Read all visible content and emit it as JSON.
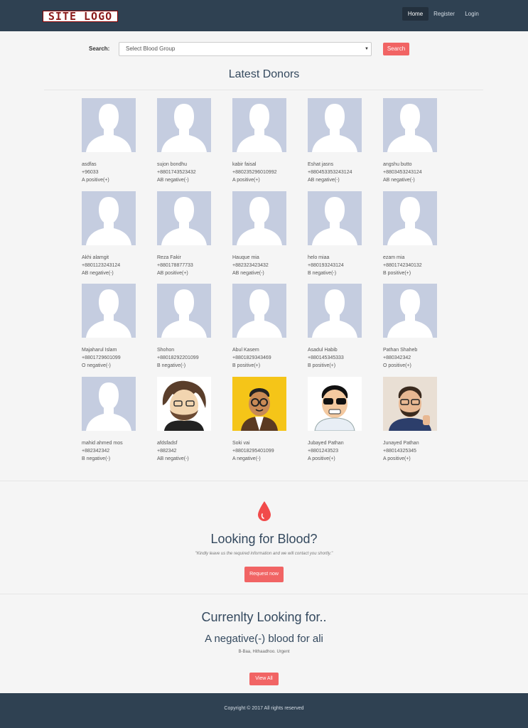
{
  "site": {
    "logo_text": "SITE LOGO"
  },
  "nav": {
    "home": "Home",
    "register": "Register",
    "login": "Login"
  },
  "search": {
    "label": "Search:",
    "select_value": "Select Blood Group",
    "button": "Search"
  },
  "donors_section": {
    "title": "Latest Donors"
  },
  "donors": [
    {
      "name": "asdfas",
      "phone": "+96033",
      "blood": "A positive(+)",
      "avatar": "placeholder"
    },
    {
      "name": "sujon bondhu",
      "phone": "+8801743523432",
      "blood": "AB negative(-)",
      "avatar": "placeholder"
    },
    {
      "name": "kabir faisal",
      "phone": "+880235296010992",
      "blood": "A positive(+)",
      "avatar": "placeholder"
    },
    {
      "name": "Eshat jasns",
      "phone": "+880453353243124",
      "blood": "AB negative(-)",
      "avatar": "placeholder"
    },
    {
      "name": "angshu butto",
      "phone": "+8803453243124",
      "blood": "AB negative(-)",
      "avatar": "placeholder"
    },
    {
      "name": "Akhi alamgit",
      "phone": "+8801123243124",
      "blood": "AB negative(-)",
      "avatar": "placeholder"
    },
    {
      "name": "Reza Fakir",
      "phone": "+880178877733",
      "blood": "AB positive(+)",
      "avatar": "placeholder"
    },
    {
      "name": "Hauque mia",
      "phone": "+882323423432",
      "blood": "AB negative(-)",
      "avatar": "placeholder"
    },
    {
      "name": "helo miaa",
      "phone": "+880193243124",
      "blood": "B negative(-)",
      "avatar": "placeholder"
    },
    {
      "name": "ezam mia",
      "phone": "+8801742340132",
      "blood": "B positive(+)",
      "avatar": "placeholder"
    },
    {
      "name": "Majaharul Islam",
      "phone": "+8801729601099",
      "blood": "O negative(-)",
      "avatar": "placeholder"
    },
    {
      "name": "Shohon",
      "phone": "+88018292201099",
      "blood": "B negative(-)",
      "avatar": "placeholder"
    },
    {
      "name": "Abul Kasem",
      "phone": "+8801829343469",
      "blood": "B positive(+)",
      "avatar": "placeholder"
    },
    {
      "name": "Asadul Habib",
      "phone": "+880145345333",
      "blood": "B positive(+)",
      "avatar": "placeholder"
    },
    {
      "name": "Pathan Shaheb",
      "phone": "+880342342",
      "blood": "O positive(+)",
      "avatar": "placeholder"
    },
    {
      "name": "mahid ahmed mos",
      "phone": "+882342342",
      "blood": "B negative(-)",
      "avatar": "placeholder"
    },
    {
      "name": "afdsfadsf",
      "phone": "+882342",
      "blood": "AB negative(-)",
      "avatar": "cartoon-long-hair"
    },
    {
      "name": "Soki vai",
      "phone": "+88018295401099",
      "blood": "A negative(-)",
      "avatar": "cartoon-glasses-yellow"
    },
    {
      "name": "Jubayed Pathan",
      "phone": "+8801243523",
      "blood": "A positive(+)",
      "avatar": "cartoon-sunglasses"
    },
    {
      "name": "Junayed Pathan",
      "phone": "+8801432534​5",
      "blood": "A positive(+)",
      "avatar": "cartoon-thumbs-up"
    }
  ],
  "looking": {
    "title": "Looking for Blood?",
    "quote": "\"Kindly leave us the required information and we will contact you shortly.\"",
    "button": "Request now"
  },
  "currently": {
    "title": "Currenlty Looking for..",
    "request": "A negative(-) blood for ali",
    "detail": "B-Baa, Hithaadhoo. Urgent",
    "button": "View All"
  },
  "footer": {
    "copyright": "Copyright © 2017 All rights reserved"
  },
  "colors": {
    "navbar": "#2f4152",
    "accent": "#f16464",
    "avatar_bg": "#c5cde0"
  },
  "icons": {
    "blood_drop": "blood-drop-icon"
  }
}
